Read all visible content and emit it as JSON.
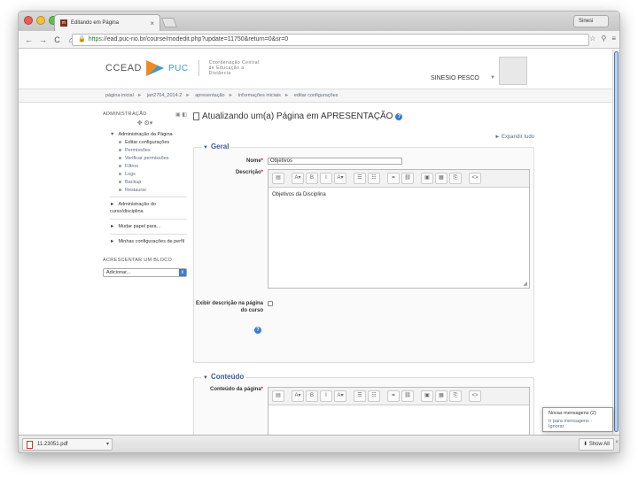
{
  "browser": {
    "tab_title": "Editando em Página",
    "tab_close": "×",
    "user_badge": "Sinesi",
    "url_scheme": "https",
    "url_rest": "://ead.puc-rio.br/course/modedit.php?update=11750&return=0&sr=0",
    "nav": {
      "back": "←",
      "forward": "→",
      "reload": "C",
      "home": "⌂"
    }
  },
  "site": {
    "logo_text": "CCEAD",
    "logo_puc": "PUC",
    "logo_sub": "Coordenação Central de Educação a Distância",
    "user_name": "SINESIO PESCO"
  },
  "breadcrumb": [
    "página inicial",
    "jan2704_2014.2",
    "apresentação",
    "Informações iniciais",
    "editar configurações"
  ],
  "sidebar": {
    "admin_title": "ADMINISTRAÇÃO",
    "tree_root": "Administração da Página",
    "tree_children": [
      "Editar configurações",
      "Permissões",
      "Verificar permissões",
      "Filtros",
      "Logs",
      "Backup",
      "Restaurar"
    ],
    "others": [
      "Administração do curso/disciplina",
      "Mudar papel para...",
      "Minhas configurações de perfil"
    ],
    "add_block_title": "ACRESCENTAR UM BLOCO",
    "add_select": "Adicionar..."
  },
  "main": {
    "title": "Atualizando um(a) Página em APRESENTAÇÃO",
    "expand_all": "Expandir tudo",
    "general_legend": "Geral",
    "name_label": "Nome",
    "name_value": "Objetivos",
    "desc_label": "Descrição",
    "desc_text": "Objetivos da Disciplina",
    "show_desc_label": "Exibir descrição na página do curso",
    "content_legend": "Conteúdo",
    "content_label": "Conteúdo da página",
    "required_mark": "*"
  },
  "editor_toolbar": [
    "▤",
    "A▾",
    "B",
    "I",
    "A▾",
    "☰",
    "☷",
    "⚭",
    "⛓",
    "▣",
    "▦",
    "⎘",
    "<>"
  ],
  "notification": {
    "title": "Novas mensagens (2)",
    "go": "Ir para mensagens",
    "ignore": "Ignorar"
  },
  "downloads": {
    "file": "11.23051.pdf",
    "show_all": "Show All",
    "close": "×"
  }
}
